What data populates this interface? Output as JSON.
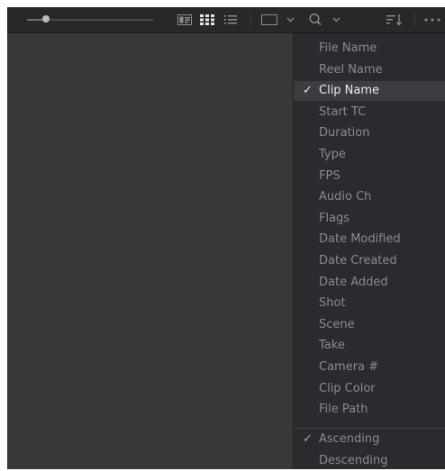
{
  "toolbar": {
    "zoom_level": 0.15,
    "icons": [
      "filmstrip-view-icon",
      "thumbnail-grid-icon",
      "list-view-icon",
      "clip-viewer-icon",
      "search-icon",
      "sort-icon",
      "more-options-icon"
    ],
    "colors": {
      "background": "#28282b",
      "icon": "#8e8d92",
      "icon_active": "#e6e5ea"
    }
  },
  "sort_menu": {
    "fields": [
      {
        "label": "File Name",
        "checked": false
      },
      {
        "label": "Reel Name",
        "checked": false
      },
      {
        "label": "Clip Name",
        "checked": true
      },
      {
        "label": "Start TC",
        "checked": false
      },
      {
        "label": "Duration",
        "checked": false
      },
      {
        "label": "Type",
        "checked": false
      },
      {
        "label": "FPS",
        "checked": false
      },
      {
        "label": "Audio Ch",
        "checked": false
      },
      {
        "label": "Flags",
        "checked": false
      },
      {
        "label": "Date Modified",
        "checked": false
      },
      {
        "label": "Date Created",
        "checked": false
      },
      {
        "label": "Date Added",
        "checked": false
      },
      {
        "label": "Shot",
        "checked": false
      },
      {
        "label": "Scene",
        "checked": false
      },
      {
        "label": "Take",
        "checked": false
      },
      {
        "label": "Camera #",
        "checked": false
      },
      {
        "label": "Clip Color",
        "checked": false
      },
      {
        "label": "File Path",
        "checked": false
      }
    ],
    "order": [
      {
        "label": "Ascending",
        "checked": true
      },
      {
        "label": "Descending",
        "checked": false
      }
    ],
    "check_glyph": "✓",
    "colors": {
      "background": "#2b2a2e",
      "text": "#8b8a90",
      "selected_text": "#ecebef",
      "selected_bg": "#3d3c40"
    }
  },
  "media_pool": {
    "background": "#3a373b"
  }
}
